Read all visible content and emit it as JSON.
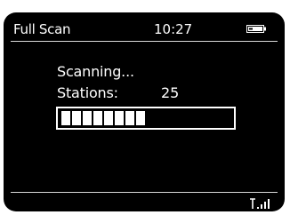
{
  "header": {
    "title": "Full Scan",
    "clock": "10:27"
  },
  "scan": {
    "status_text": "Scanning...",
    "stations_label": "Stations:",
    "stations_count": "25",
    "progress": 0.5
  },
  "icons": {
    "battery": "battery-icon",
    "signal": "signal-strength-icon"
  },
  "colors": {
    "screen_bg": "#000000",
    "foreground": "#ffffff",
    "divider": "#d9d9d9"
  }
}
